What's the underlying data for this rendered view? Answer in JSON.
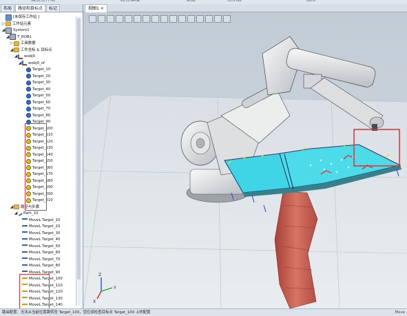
{
  "top_menu": [
    "建立工作站",
    "路径编程",
    "设置",
    "控制器",
    "Freehand",
    "图形"
  ],
  "left_tabs": [
    "布局",
    "路径和目标点",
    "标记"
  ],
  "tree": [
    {
      "label": "[未保存工作站 ]",
      "indent": 0,
      "icon": "station",
      "expander": ""
    },
    {
      "label": "工作站元素",
      "indent": 0,
      "icon": "folder",
      "expander": "▷"
    },
    {
      "label": "System1",
      "indent": 0,
      "icon": "robot",
      "expander": "◢"
    },
    {
      "label": "T_ROB1",
      "indent": 1,
      "icon": "robot",
      "expander": "◢"
    },
    {
      "label": "工具数据",
      "indent": 2,
      "icon": "folder",
      "expander": "▷"
    },
    {
      "label": "工件坐标 & 目标点",
      "indent": 2,
      "icon": "folder",
      "expander": "◢"
    },
    {
      "label": "wobj0",
      "indent": 3,
      "icon": "wobj",
      "expander": "◢"
    },
    {
      "label": "wobj0_of",
      "indent": 4,
      "icon": "wobj",
      "expander": "◢"
    },
    {
      "label": "Target_10",
      "indent": 5,
      "icon": "target",
      "expander": ""
    },
    {
      "label": "Target_20",
      "indent": 5,
      "icon": "target",
      "expander": ""
    },
    {
      "label": "Target_30",
      "indent": 5,
      "icon": "target",
      "expander": ""
    },
    {
      "label": "Target_40",
      "indent": 5,
      "icon": "target",
      "expander": ""
    },
    {
      "label": "Target_50",
      "indent": 5,
      "icon": "target",
      "expander": ""
    },
    {
      "label": "Target_60",
      "indent": 5,
      "icon": "target",
      "expander": ""
    },
    {
      "label": "Target_70",
      "indent": 5,
      "icon": "target",
      "expander": ""
    },
    {
      "label": "Target_80",
      "indent": 5,
      "icon": "target",
      "expander": ""
    },
    {
      "label": "Target_90",
      "indent": 5,
      "icon": "target",
      "expander": ""
    },
    {
      "label": "Target_100",
      "indent": 5,
      "icon": "target-warn",
      "expander": ""
    },
    {
      "label": "Target_110",
      "indent": 5,
      "icon": "target-warn",
      "expander": ""
    },
    {
      "label": "Target_120",
      "indent": 5,
      "icon": "target-warn",
      "expander": ""
    },
    {
      "label": "Target_130",
      "indent": 5,
      "icon": "target-warn",
      "expander": ""
    },
    {
      "label": "Target_140",
      "indent": 5,
      "icon": "target-warn",
      "expander": ""
    },
    {
      "label": "Target_150",
      "indent": 5,
      "icon": "target-warn",
      "expander": ""
    },
    {
      "label": "Target_160",
      "indent": 5,
      "icon": "target-warn",
      "expander": ""
    },
    {
      "label": "Target_170",
      "indent": 5,
      "icon": "target-warn",
      "expander": ""
    },
    {
      "label": "Target_180",
      "indent": 5,
      "icon": "target-warn",
      "expander": ""
    },
    {
      "label": "Target_190",
      "indent": 5,
      "icon": "target-warn",
      "expander": ""
    },
    {
      "label": "Target_200",
      "indent": 5,
      "icon": "target-warn",
      "expander": ""
    },
    {
      "label": "Target_210",
      "indent": 5,
      "icon": "target-warn",
      "expander": ""
    },
    {
      "label": "路径与步骤",
      "indent": 2,
      "icon": "folder",
      "expander": "◢"
    },
    {
      "label": "Path_10",
      "indent": 3,
      "icon": "path",
      "expander": "◢"
    },
    {
      "label": "MoveL Target_10",
      "indent": 4,
      "icon": "move",
      "expander": ""
    },
    {
      "label": "MoveL Target_20",
      "indent": 4,
      "icon": "move",
      "expander": ""
    },
    {
      "label": "MoveL Target_30",
      "indent": 4,
      "icon": "move",
      "expander": ""
    },
    {
      "label": "MoveL Target_40",
      "indent": 4,
      "icon": "move",
      "expander": ""
    },
    {
      "label": "MoveL Target_50",
      "indent": 4,
      "icon": "move",
      "expander": ""
    },
    {
      "label": "MoveL Target_60",
      "indent": 4,
      "icon": "move",
      "expander": ""
    },
    {
      "label": "MoveL Target_70",
      "indent": 4,
      "icon": "move",
      "expander": ""
    },
    {
      "label": "MoveL Target_80",
      "indent": 4,
      "icon": "move",
      "expander": ""
    },
    {
      "label": "MoveL Target_90",
      "indent": 4,
      "icon": "move",
      "expander": ""
    },
    {
      "label": "MoveL Target_100",
      "indent": 4,
      "icon": "move-warn",
      "expander": ""
    },
    {
      "label": "MoveL Target_110",
      "indent": 4,
      "icon": "move-warn",
      "expander": ""
    },
    {
      "label": "MoveL Target_120",
      "indent": 4,
      "icon": "move-warn",
      "expander": ""
    },
    {
      "label": "MoveL Target_130",
      "indent": 4,
      "icon": "move-warn",
      "expander": ""
    },
    {
      "label": "MoveL Target_140",
      "indent": 4,
      "icon": "move-warn",
      "expander": ""
    }
  ],
  "viewport_tab": "视图1 ×",
  "axis_labels": {
    "x": "X",
    "y": "Y",
    "z": "Z"
  },
  "status": {
    "message": "路由配置：无法从当前位置跳转至 Target_100，您应该检查目标点 Target_100 上的配置",
    "right": "Move"
  },
  "colors": {
    "highlight_box": "#e03030",
    "part_surface": "#46d8e8",
    "robot_body": "#e6e6e6",
    "pedestal": "#c4584f",
    "floor": "#dfe5ea"
  },
  "icons": [
    "station-icon",
    "folder-icon",
    "robot-icon",
    "workobject-icon",
    "target-icon",
    "path-icon",
    "movel-icon"
  ]
}
